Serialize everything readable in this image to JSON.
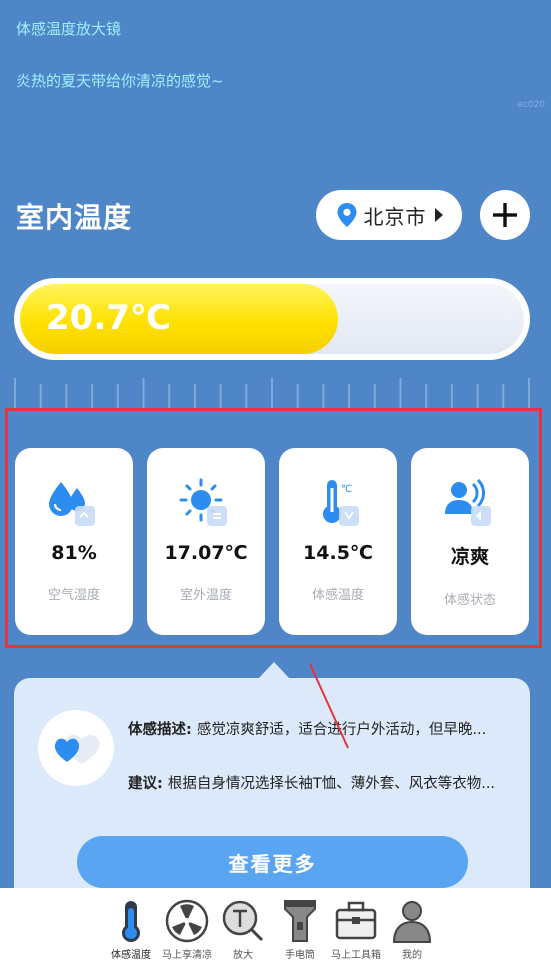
{
  "header": {
    "title": "体感温度放大镜",
    "subtitle": "炎热的夏天带给你清凉的感觉~",
    "tag": "ec020"
  },
  "indoor": {
    "title": "室内温度",
    "city": "北京市",
    "temperature": "20.7℃",
    "fill_fraction": 0.63
  },
  "cards": [
    {
      "value": "81%",
      "label": "空气湿度",
      "icon": "humidity-icon"
    },
    {
      "value": "17.07℃",
      "label": "室外温度",
      "icon": "sun-icon"
    },
    {
      "value": "14.5℃",
      "label": "体感温度",
      "icon": "thermometer-icon"
    },
    {
      "value": "凉爽",
      "label": "体感状态",
      "icon": "person-icon"
    }
  ],
  "panel": {
    "desc_label": "体感描述: ",
    "desc_text": "感觉凉爽舒适，适合进行户外活动，但早晚...",
    "advice_label": "建议: ",
    "advice_text": "根据自身情况选择长袖T恤、薄外套、风衣等衣物...",
    "more_button": "查看更多"
  },
  "nav": [
    {
      "label": "体感温度",
      "icon": "thermometer-icon",
      "active": true
    },
    {
      "label": "马上享清凉",
      "icon": "fan-icon",
      "active": false
    },
    {
      "label": "放大",
      "icon": "magnifier-icon",
      "active": false
    },
    {
      "label": "手电筒",
      "icon": "flashlight-icon",
      "active": false
    },
    {
      "label": "马上工具箱",
      "icon": "toolbox-icon",
      "active": false
    },
    {
      "label": "我的",
      "icon": "user-icon",
      "active": false
    }
  ],
  "colors": {
    "background": "#4f86c8",
    "accent_yellow": "#ffe100",
    "accent_blue": "#2d8cf0",
    "highlight_red": "#e8333a"
  }
}
